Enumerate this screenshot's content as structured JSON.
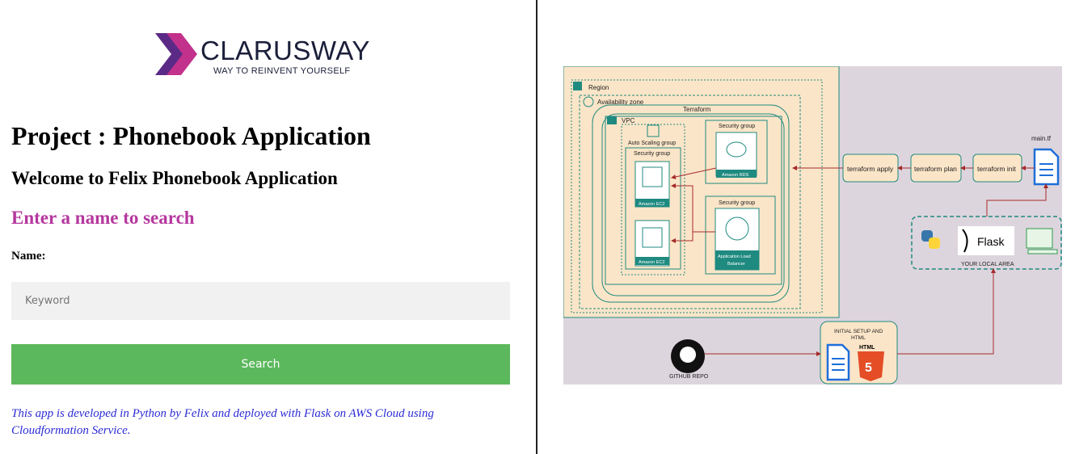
{
  "brand": {
    "name": "CLARUSWAY",
    "tagline": "WAY TO REINVENT YOURSELF",
    "accent": "#8e3aa8"
  },
  "page": {
    "title": "Project : Phonebook Application",
    "welcome": "Welcome to Felix Phonebook Application",
    "search_heading": "Enter a name to search"
  },
  "form": {
    "name_label": "Name:",
    "keyword_placeholder": "Keyword",
    "search_label": "Search"
  },
  "footer": "This app is developed in Python by Felix and deployed with Flask on AWS Cloud using Cloudformation Service.",
  "colors": {
    "search_heading": "#b5379e",
    "button": "#5cb85c",
    "footer": "#2b2bd6",
    "arrow": "#a52a2a",
    "teal": "#1f8a80"
  },
  "diagram": {
    "region": "Region",
    "availability_zone": "Availability zone",
    "terraform": "Terraform",
    "vpc": "VPC",
    "auto_scaling": "Auto Scaling group",
    "security_group": "Security group",
    "ec2_a": "Amazon EC2",
    "ec2_b": "Amazon EC2",
    "rds": "Amazon RDS",
    "alb_line1": "Application Load",
    "alb_line2": "Balancer",
    "terraform_apply": "terraform apply",
    "terraform_plan": "terraform plan",
    "terraform_init": "terraform init",
    "main_tf": "main.tf",
    "local_area": "YOUR LOCAL AREA",
    "flask": "Flask",
    "initial_setup_line1": "INITIAL SETUP AND",
    "initial_setup_line2": "HTML",
    "html_badge": "HTML",
    "github_repo": "GITHUB REPO"
  }
}
